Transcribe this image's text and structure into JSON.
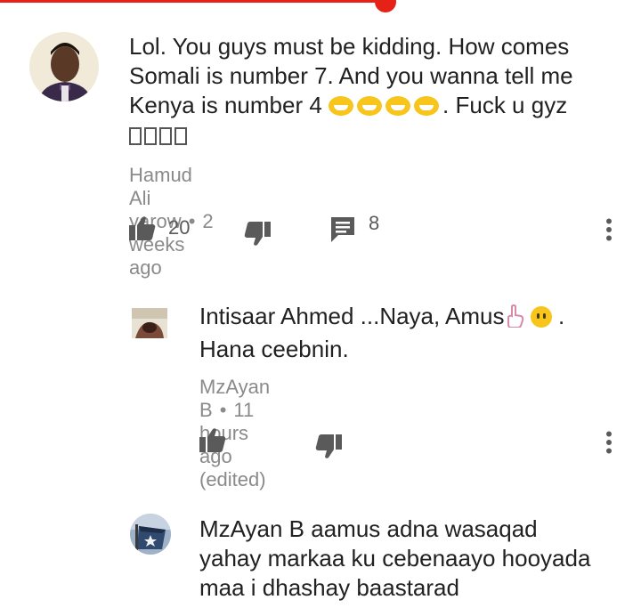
{
  "comments": [
    {
      "text_before": "Lol. You guys must be kidding. How comes Somali is number 7. And you wanna tell me Kenya is number 4",
      "text_after": ". Fuck u gyz",
      "author": "Hamud Ali yarow",
      "time": "2 weeks ago",
      "likes": "20",
      "replies": "8"
    },
    {
      "text_before": "Intisaar Ahmed ...Naya, Amus",
      "text_after": " .",
      "text_line2": "Hana ceebnin.",
      "author": "MzAyan B",
      "time": "11 hours ago (edited)"
    },
    {
      "text_line1": "MzAyan B aamus adna wasaqad",
      "text_line2": "yahay markaa ku cebenaayo hooyada",
      "text_line3": "maa i dhashay baastarad"
    }
  ],
  "progress_fraction": 0.6,
  "colors": {
    "progress": "#e62117",
    "meta": "#8a8a8a",
    "text": "#212121"
  }
}
